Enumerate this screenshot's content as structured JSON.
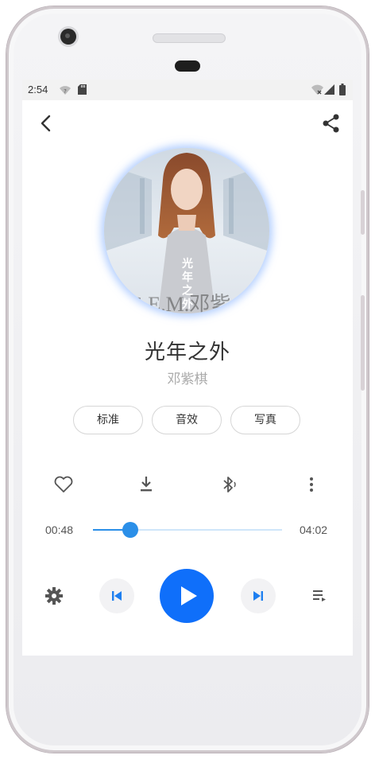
{
  "status": {
    "time": "2:54"
  },
  "song": {
    "title": "光年之外",
    "artist": "邓紫棋",
    "album_caption": "光年之外",
    "album_watermark": "G.E.M.邓紫"
  },
  "modes": [
    "标准",
    "音效",
    "写真"
  ],
  "progress": {
    "current": "00:48",
    "total": "04:02",
    "fraction": 0.199
  },
  "accent_color": "#0f6ffa",
  "icons": [
    "back-icon",
    "share-icon",
    "heart-icon",
    "download-icon",
    "bluetooth-icon",
    "more-icon",
    "settings-icon",
    "previous-icon",
    "play-icon",
    "next-icon",
    "playlist-icon"
  ]
}
